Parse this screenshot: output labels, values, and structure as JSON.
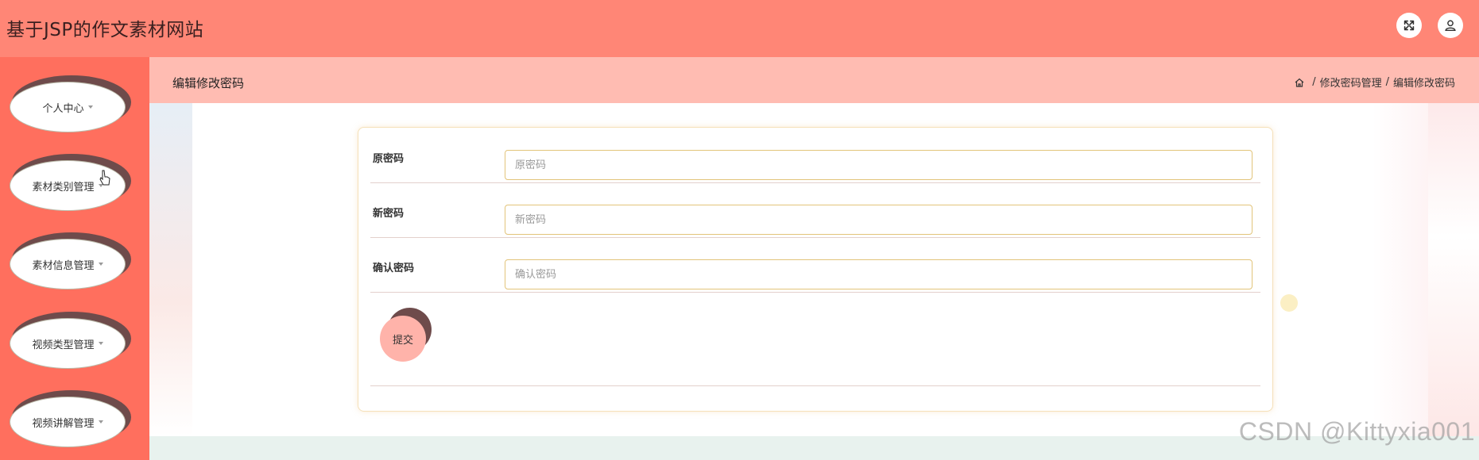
{
  "app": {
    "title": "基于JSP的作文素材网站"
  },
  "topbar": {
    "icons": [
      "fullscreen-icon",
      "user-icon"
    ]
  },
  "sidebar": {
    "items": [
      {
        "label": "个人中心"
      },
      {
        "label": "素材类别管理"
      },
      {
        "label": "素材信息管理"
      },
      {
        "label": "视频类型管理"
      },
      {
        "label": "视频讲解管理"
      }
    ]
  },
  "header": {
    "page_title": "编辑修改密码",
    "breadcrumb": [
      "修改密码管理",
      "编辑修改密码"
    ],
    "breadcrumb_separator": "/"
  },
  "form": {
    "fields": [
      {
        "label": "原密码",
        "placeholder": "原密码"
      },
      {
        "label": "新密码",
        "placeholder": "新密码"
      },
      {
        "label": "确认密码",
        "placeholder": "确认密码"
      }
    ],
    "submit_label": "提交"
  },
  "watermark": "CSDN @Kittyxia001",
  "colors": {
    "topbar": "#ff8676",
    "sidebar": "#ff6f5e",
    "header_band": "#ffbcb2",
    "submit_button": "#ffb3aa",
    "input_border": "#e2c47a"
  }
}
